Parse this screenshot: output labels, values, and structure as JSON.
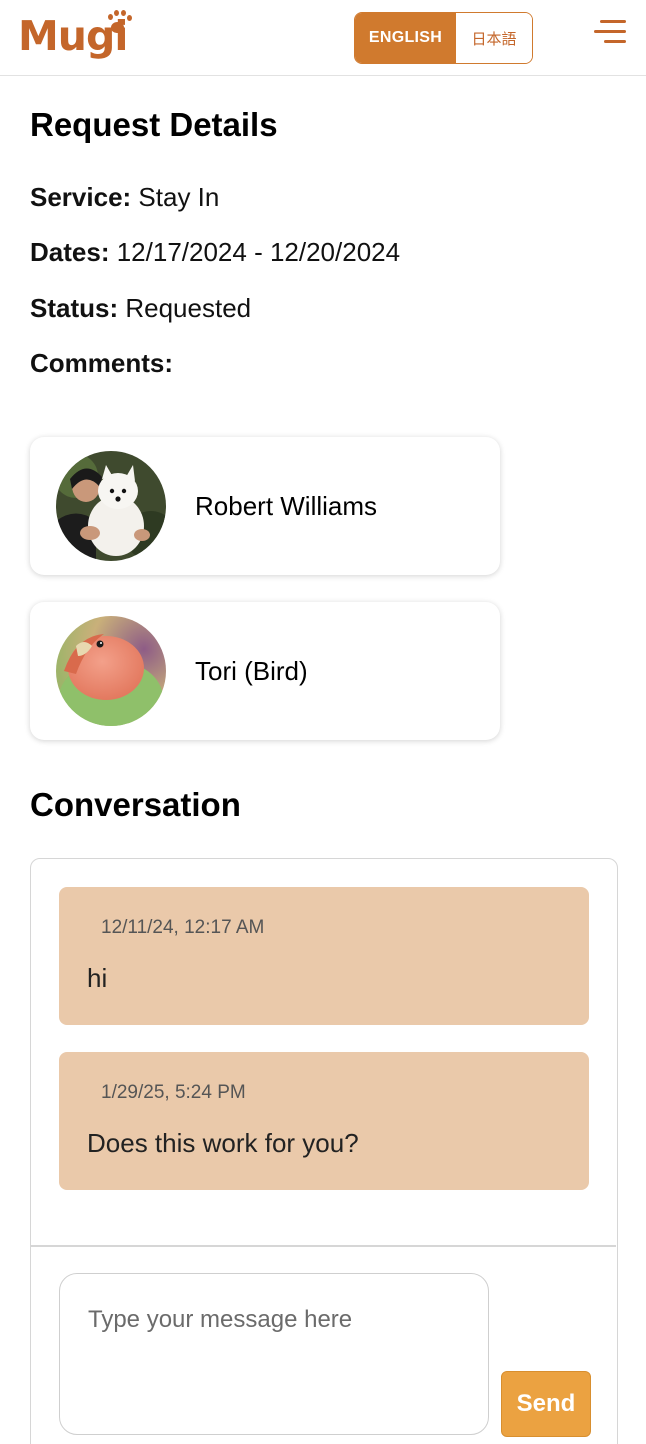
{
  "header": {
    "logo_text": "Mugi",
    "lang_english": "ENGLISH",
    "lang_japanese": "日本語",
    "menu_icon": "hamburger-menu-icon"
  },
  "request": {
    "title": "Request Details",
    "service_label": "Service:",
    "service_value": "Stay In",
    "dates_label": "Dates:",
    "dates_value": "12/17/2024 - 12/20/2024",
    "status_label": "Status:",
    "status_value": "Requested",
    "comments_label": "Comments:",
    "comments_value": ""
  },
  "cards": [
    {
      "name": "Robert Williams",
      "avatar": "owner-with-white-dog-photo"
    },
    {
      "name": "Tori (Bird)",
      "avatar": "lovebird-photo"
    }
  ],
  "conversation": {
    "title": "Conversation",
    "messages": [
      {
        "time": "12/11/24, 12:17 AM",
        "text": "hi"
      },
      {
        "time": "1/29/25, 5:24 PM",
        "text": "Does this work for you?"
      }
    ],
    "input_placeholder": "Type your message here",
    "input_value": "",
    "send_label": "Send"
  },
  "colors": {
    "brand": "#c4662a",
    "toggle_active": "#d07a2e",
    "message_bubble": "#eac9aa",
    "send_button": "#eba241"
  }
}
